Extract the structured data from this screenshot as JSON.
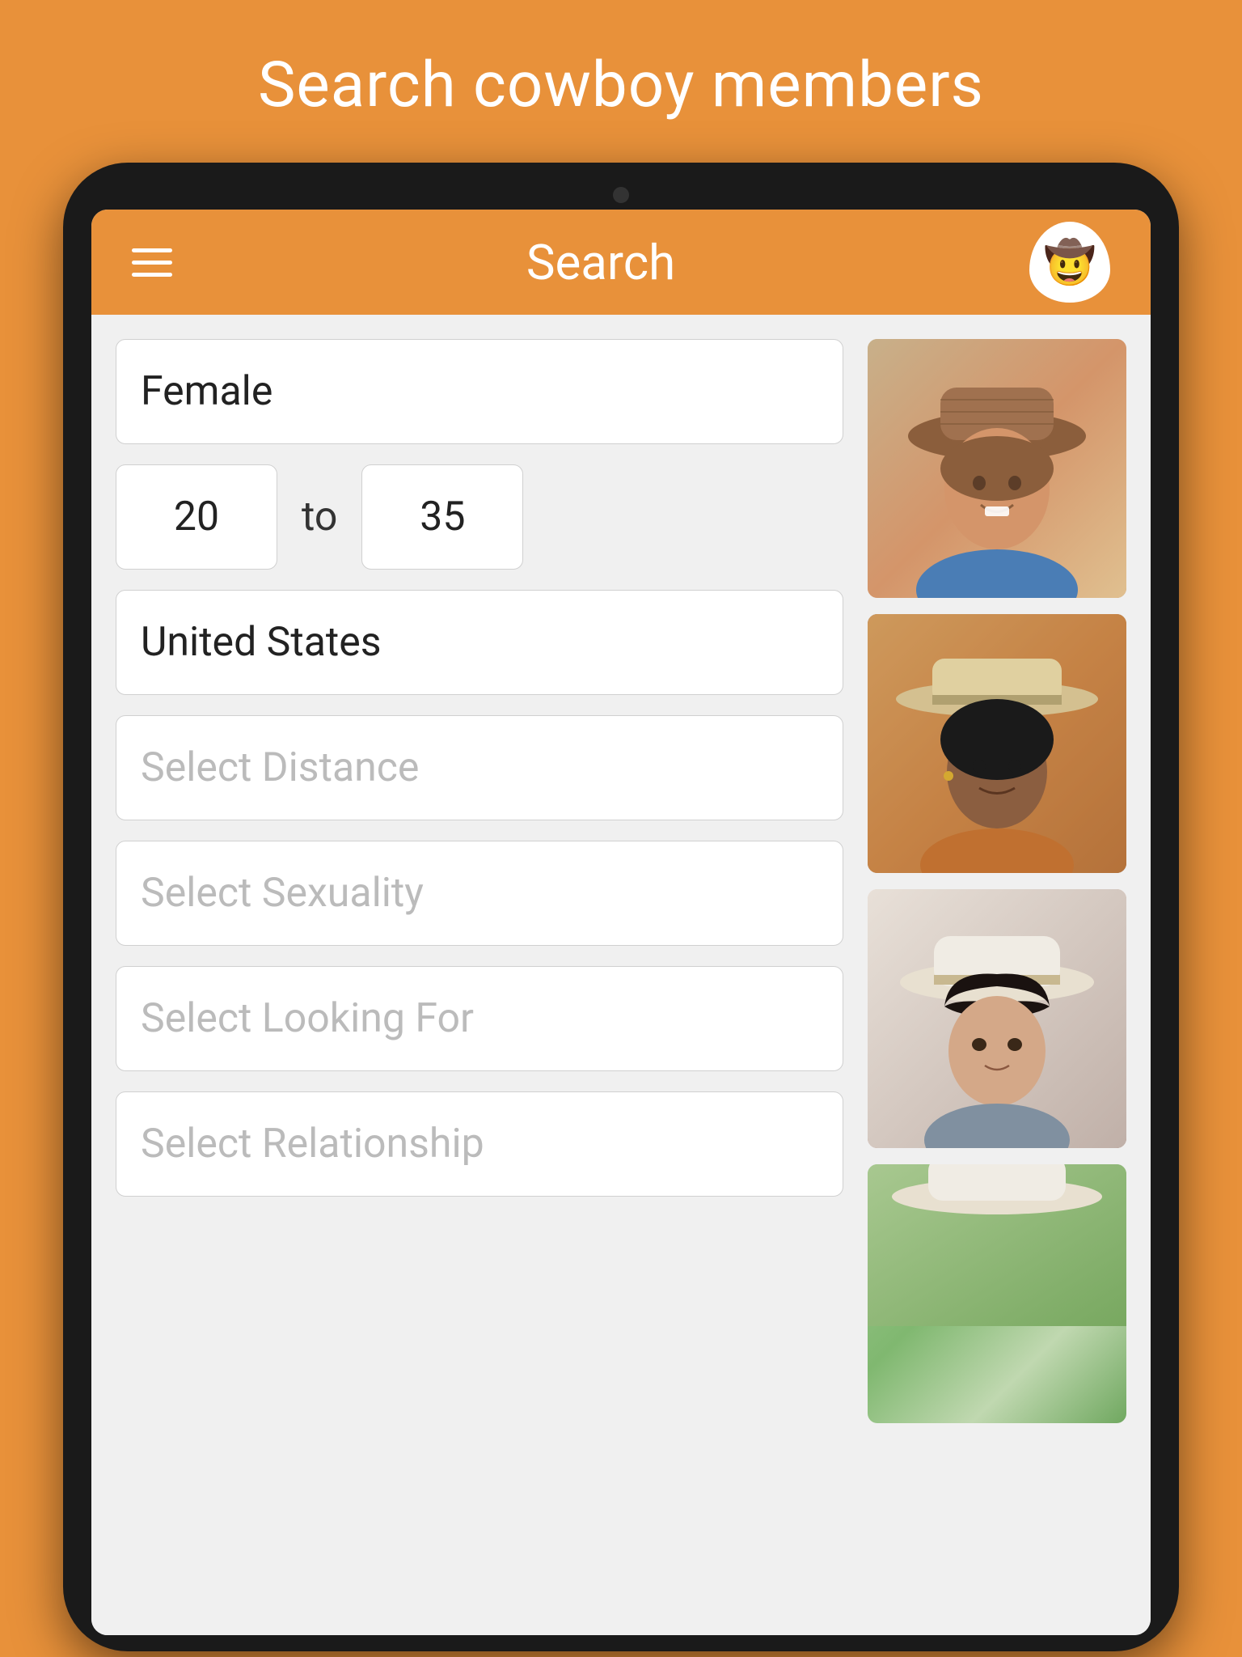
{
  "header": {
    "page_title": "Search cowboy members",
    "app_title": "Search",
    "menu_icon": "☰",
    "logo_emoji": "🤠"
  },
  "form": {
    "gender": {
      "value": "Female",
      "is_placeholder": false
    },
    "age_from": {
      "value": "20"
    },
    "age_to_separator": "to",
    "age_to": {
      "value": "35"
    },
    "country": {
      "value": "United States",
      "is_placeholder": false
    },
    "distance": {
      "value": "Select Distance",
      "is_placeholder": true
    },
    "sexuality": {
      "value": "Select Sexuality",
      "is_placeholder": true
    },
    "looking_for": {
      "value": "Select Looking For",
      "is_placeholder": true
    },
    "relationship": {
      "value": "Select Relationship",
      "is_placeholder": true
    }
  },
  "photos": [
    {
      "alt": "Woman with cowboy hat smiling"
    },
    {
      "alt": "Woman with light hat"
    },
    {
      "alt": "Woman with white hat"
    },
    {
      "alt": "Partial photo"
    }
  ]
}
